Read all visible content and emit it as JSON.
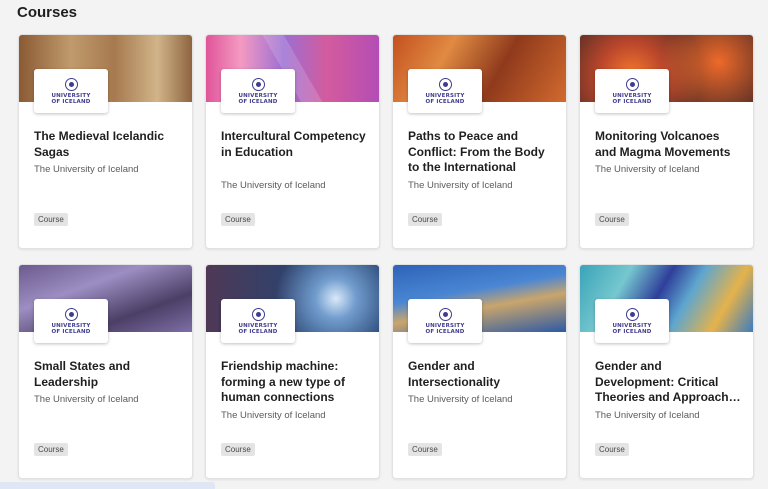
{
  "section": {
    "title": "Courses"
  },
  "logo": {
    "line1": "UNIVERSITY",
    "line2": "OF ICELAND"
  },
  "courses": [
    {
      "title": "The Medieval Icelandic Sagas",
      "provider": "The University of Iceland",
      "tag": "Course",
      "image": "medieval-manuscript"
    },
    {
      "title": "Intercultural Competency in Education",
      "provider": "The University of Iceland",
      "tag": "Course",
      "image": "colorful-geometric-pattern"
    },
    {
      "title": "Paths to Peace and Conflict: From the Body to the International",
      "provider": "The University of Iceland",
      "tag": "Course",
      "image": "conflict-fire-scene"
    },
    {
      "title": "Monitoring Volcanoes and Magma Movements",
      "provider": "The University of Iceland",
      "tag": "Course",
      "image": "lava-flow"
    },
    {
      "title": "Small States and Leadership",
      "provider": "The University of Iceland",
      "tag": "Course",
      "image": "purple-globe"
    },
    {
      "title": "Friendship machine: forming a new type of human connections",
      "provider": "The University of Iceland",
      "tag": "Course",
      "image": "space-planets"
    },
    {
      "title": "Gender and Intersectionality",
      "provider": "The University of Iceland",
      "tag": "Course",
      "image": "letter-tiles"
    },
    {
      "title": "Gender and Development: Critical Theories and Approach…",
      "provider": "The University of Iceland",
      "tag": "Course",
      "image": "world-map-art"
    }
  ],
  "colors": {
    "logo": "#3e3c8e",
    "tag_bg": "#e4e4e4",
    "page_bg": "#f3f3f3"
  }
}
